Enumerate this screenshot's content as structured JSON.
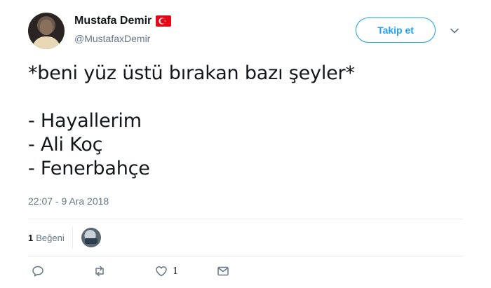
{
  "author": {
    "display_name": "Mustafa Demir",
    "handle": "@MustafaxDemir",
    "badge_icon": "turkey-flag-icon"
  },
  "follow_button": {
    "label": "Takip et"
  },
  "tweet": {
    "text": "*beni yüz üstü bırakan bazı şeyler*\n\n- Hayallerim\n- Ali Koç\n- Fenerbahçe",
    "timestamp": "22:07 - 9 Ara 2018"
  },
  "stats": {
    "likes_count": "1",
    "likes_label": "Beğeni"
  },
  "actions": {
    "reply_icon": "reply-icon",
    "retweet_icon": "retweet-icon",
    "like_icon": "heart-icon",
    "like_count": "1",
    "dm_icon": "envelope-icon"
  },
  "colors": {
    "accent": "#1da1f2",
    "secondary_text": "#657786",
    "divider": "#e6ecf0"
  }
}
